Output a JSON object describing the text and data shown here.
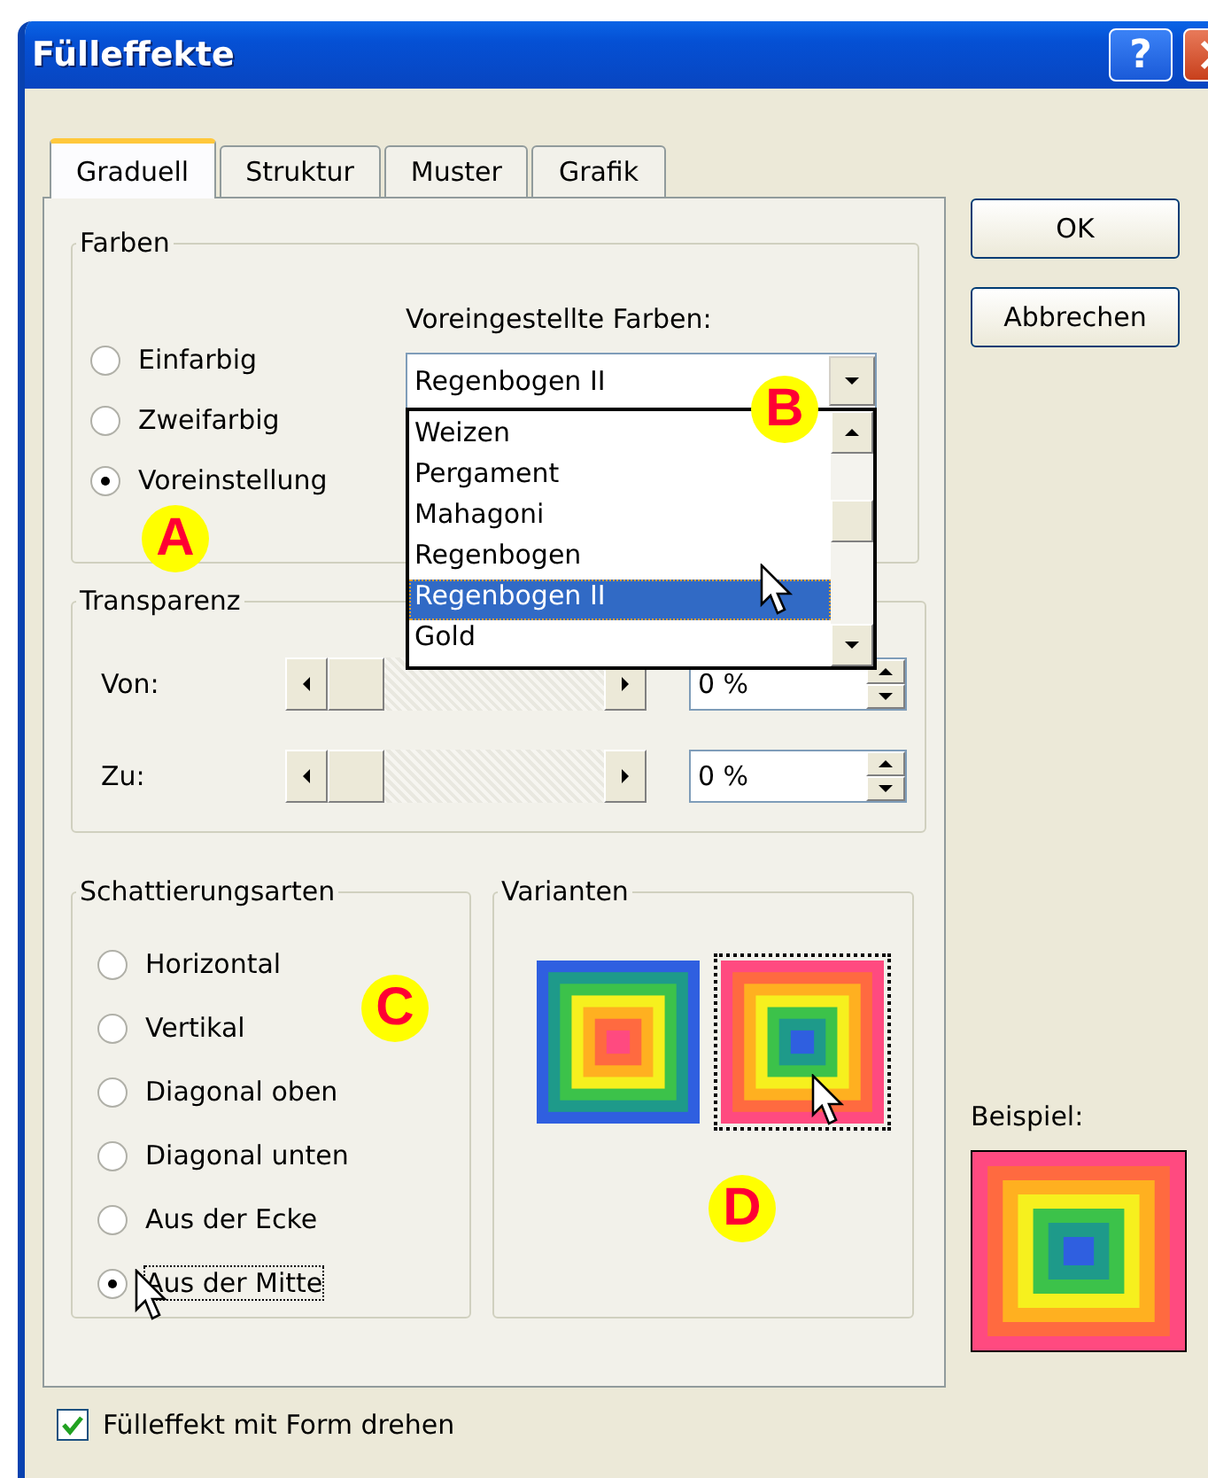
{
  "window": {
    "title": "Fülleffekte"
  },
  "title_buttons": [
    {
      "kind": "help",
      "label": "?"
    },
    {
      "kind": "close"
    }
  ],
  "tabs": [
    {
      "label": "Graduell",
      "selected": true
    },
    {
      "label": "Struktur",
      "selected": false
    },
    {
      "label": "Muster",
      "selected": false
    },
    {
      "label": "Grafik",
      "selected": false
    }
  ],
  "colors": {
    "title": "Farben",
    "options": [
      {
        "label": "Einfarbig",
        "selected": false
      },
      {
        "label": "Zweifarbig",
        "selected": false
      },
      {
        "label": "Voreinstellung",
        "selected": true
      }
    ],
    "preset_label": "Voreingestellte Farben:",
    "preset_value": "Regenbogen II",
    "preset_list": [
      {
        "label": "Weizen",
        "selected": false
      },
      {
        "label": "Pergament",
        "selected": false
      },
      {
        "label": "Mahagoni",
        "selected": false
      },
      {
        "label": "Regenbogen",
        "selected": false
      },
      {
        "label": "Regenbogen II",
        "selected": true
      },
      {
        "label": "Gold",
        "selected": false
      }
    ]
  },
  "transparency": {
    "title": "Transparenz",
    "rows": [
      {
        "label": "Von:",
        "level": 0,
        "value": "0 %"
      },
      {
        "label": "Zu:",
        "level": 0,
        "value": "0 %"
      }
    ]
  },
  "shading": {
    "title": "Schattierungsarten",
    "options": [
      {
        "label": "Horizontal",
        "selected": false
      },
      {
        "label": "Vertikal",
        "selected": false
      },
      {
        "label": "Diagonal oben",
        "selected": false
      },
      {
        "label": "Diagonal unten",
        "selected": false
      },
      {
        "label": "Aus der Ecke",
        "selected": false
      },
      {
        "label": "Aus der Mitte",
        "selected": true
      }
    ]
  },
  "variants": {
    "title": "Varianten",
    "items": [
      {
        "kind": "blue-outside",
        "selected": false
      },
      {
        "kind": "pink-outside",
        "selected": true
      }
    ]
  },
  "buttons": [
    "OK",
    "Abbrechen"
  ],
  "sample": {
    "label": "Beispiel:",
    "kind": "pink-outside"
  },
  "rotate_with_shape": {
    "label": "Fülleffekt mit Form drehen",
    "checked": true
  },
  "annotations": [
    {
      "label": "A"
    },
    {
      "label": "B"
    },
    {
      "label": "C"
    },
    {
      "label": "D"
    }
  ]
}
